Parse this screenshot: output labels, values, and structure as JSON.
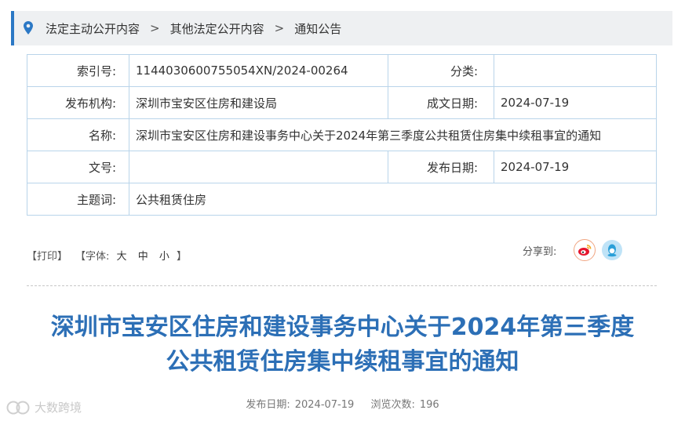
{
  "breadcrumb": {
    "items": [
      "法定主动公开内容",
      "其他法定公开内容",
      "通知公告"
    ],
    "separator": ">"
  },
  "meta": {
    "index_label": "索引号:",
    "index_value": "1144030600755054XN/2024-00264",
    "category_label": "分类:",
    "category_value": "",
    "publisher_label": "发布机构:",
    "publisher_value": "深圳市宝安区住房和建设局",
    "made_date_label": "成文日期:",
    "made_date_value": "2024-07-19",
    "name_label": "名称:",
    "name_value": "深圳市宝安区住房和建设事务中心关于2024年第三季度公共租赁住房集中续租事宜的通知",
    "doc_no_label": "文号:",
    "doc_no_value": "",
    "pub_date_label": "发布日期:",
    "pub_date_value": "2024-07-19",
    "subject_label": "主题词:",
    "subject_value": "公共租赁住房"
  },
  "tools": {
    "print": "【打印】",
    "font_prefix": "【字体:",
    "font_large": "大",
    "font_medium": "中",
    "font_small": "小",
    "font_suffix": "】",
    "share_label": "分享到:"
  },
  "article": {
    "title_line1": "深圳市宝安区住房和建设事务中心关于2024年第三季度",
    "title_line2": "公共租赁住房集中续租事宜的通知",
    "pub_date_label": "发布日期:",
    "pub_date_value": "2024-07-19",
    "views_label": "浏览次数:",
    "views_value": "196"
  },
  "watermark": {
    "text": "大数跨境"
  },
  "colors": {
    "accent": "#2b78c5",
    "title": "#2c6fb6",
    "table_border": "#b9d4ea"
  },
  "icons": [
    "location-pin-icon",
    "chevron-right-icon",
    "weibo-icon",
    "qq-icon"
  ]
}
